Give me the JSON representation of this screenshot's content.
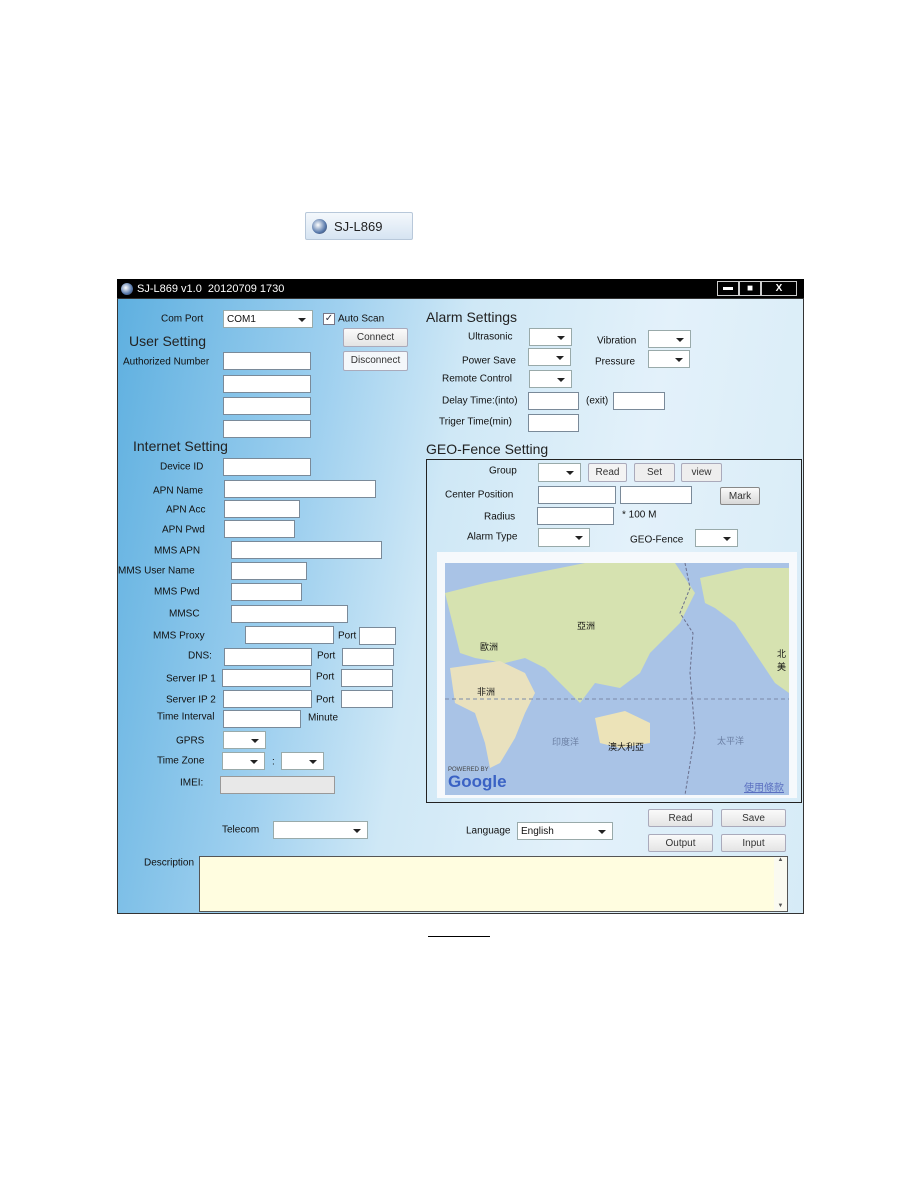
{
  "taskbar": {
    "label": "SJ-L869"
  },
  "window": {
    "title": "SJ-L869 v1.0  20120709 1730",
    "controls": [
      "minimize",
      "maximize",
      "close"
    ]
  },
  "connection": {
    "com_port_label": "Com Port",
    "com_port_value": "COM1",
    "auto_scan_label": "Auto Scan",
    "auto_scan_checked": true,
    "connect": "Connect",
    "disconnect": "Disconnect"
  },
  "user_setting": {
    "title": "User Setting",
    "authorized_number": "Authorized Number"
  },
  "internet": {
    "title": "Internet Setting",
    "device_id": "Device ID",
    "apn_name": "APN Name",
    "apn_acc": "APN Acc",
    "apn_pwd": "APN Pwd",
    "mms_apn": "MMS APN",
    "mms_user": "MMS User Name",
    "mms_pwd": "MMS Pwd",
    "mmsc": "MMSC",
    "mms_proxy": "MMS Proxy",
    "port": "Port",
    "dns": "DNS:",
    "server_ip1": "Server IP 1",
    "server_ip2": "Server IP 2",
    "time_interval": "Time Interval",
    "minute": "Minute",
    "gprs": "GPRS",
    "time_zone": "Time Zone",
    "colon": ":",
    "imei": "IMEI:"
  },
  "bottom": {
    "telecom": "Telecom",
    "description": "Description",
    "language": "Language",
    "language_value": "English",
    "read": "Read",
    "save": "Save",
    "output": "Output",
    "input": "Input"
  },
  "alarm": {
    "title": "Alarm Settings",
    "ultrasonic": "Ultrasonic",
    "vibration": "Vibration",
    "power_save": "Power Save",
    "pressure": "Pressure",
    "remote_control": "Remote Control",
    "delay_into": "Delay Time:(into)",
    "exit": "(exit)",
    "trigger": "Triger Time(min)"
  },
  "geofence": {
    "title": "GEO-Fence Setting",
    "group": "Group",
    "read": "Read",
    "set": "Set",
    "view": "view",
    "center": "Center Position",
    "mark": "Mark",
    "radius": "Radius",
    "radius_unit": "* 100 M",
    "alarm_type": "Alarm Type",
    "geo_fence": "GEO-Fence"
  },
  "map": {
    "labels": {
      "asia": "亞洲",
      "europe": "歐洲",
      "africa": "非洲",
      "indian_ocean": "印度洋",
      "australia": "澳大利亞",
      "pacific": "太平洋",
      "north_america": "北美"
    },
    "powered_by": "POWERED BY",
    "google": "Google",
    "terms": "使用條款"
  },
  "colors": {
    "ocean": "#a9c3e6",
    "land": "#d8e3b4",
    "desc_bg": "#fffde0",
    "title_bar": "#000000"
  }
}
